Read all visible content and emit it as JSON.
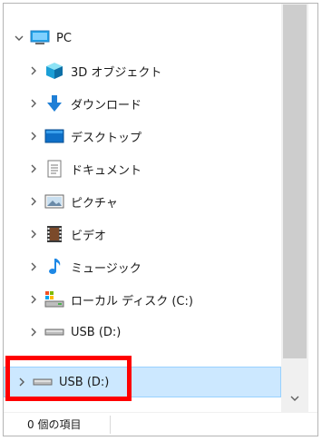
{
  "tree": {
    "root": {
      "label": "PC",
      "icon": "pc-monitor-icon"
    },
    "items": [
      {
        "label": "3D オブジェクト",
        "icon": "3d-objects-icon"
      },
      {
        "label": "ダウンロード",
        "icon": "download-arrow-icon"
      },
      {
        "label": "デスクトップ",
        "icon": "desktop-icon"
      },
      {
        "label": "ドキュメント",
        "icon": "document-icon"
      },
      {
        "label": "ピクチャ",
        "icon": "pictures-icon"
      },
      {
        "label": "ビデオ",
        "icon": "video-icon"
      },
      {
        "label": "ミュージック",
        "icon": "music-note-icon"
      },
      {
        "label": "ローカル ディスク (C:)",
        "icon": "local-disk-icon"
      },
      {
        "label": "USB (D:)",
        "icon": "usb-drive-icon"
      }
    ],
    "selected": {
      "label": "USB (D:)",
      "icon": "usb-drive-icon"
    }
  },
  "status": {
    "item_count": "0 個の項目"
  },
  "colors": {
    "selection_bg": "#cce8ff",
    "selection_border": "#99d1ff",
    "highlight_box": "#ff0000"
  }
}
